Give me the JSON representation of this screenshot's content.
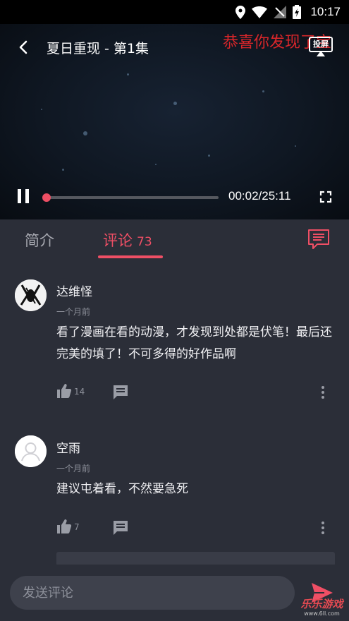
{
  "status_bar": {
    "time": "10:17"
  },
  "player": {
    "title": "夏日重现 - 第1集",
    "danmaku": "恭喜你发现了宝",
    "cast_label": "投屏",
    "current_time": "00:02/25:11",
    "progress": 0.0013
  },
  "tabs": {
    "intro": "简介",
    "comments": "评论",
    "comment_count": "73"
  },
  "comments": [
    {
      "username": "达维怪",
      "time": "一个月前",
      "content": "看了漫画在看的动漫，才发现到处都是伏笔！最后还完美的填了！不可多得的好作品啊",
      "likes": "14"
    },
    {
      "username": "空雨",
      "time": "一个月前",
      "content": "建议屯着看，不然要急死",
      "likes": "7"
    }
  ],
  "input": {
    "placeholder": "发送评论"
  },
  "watermark": {
    "main": "乐乐游戏",
    "sub": "www.6ll.com"
  },
  "colors": {
    "accent": "#ef4f65",
    "background": "#2b2e38",
    "danmaku": "#d8262a"
  }
}
